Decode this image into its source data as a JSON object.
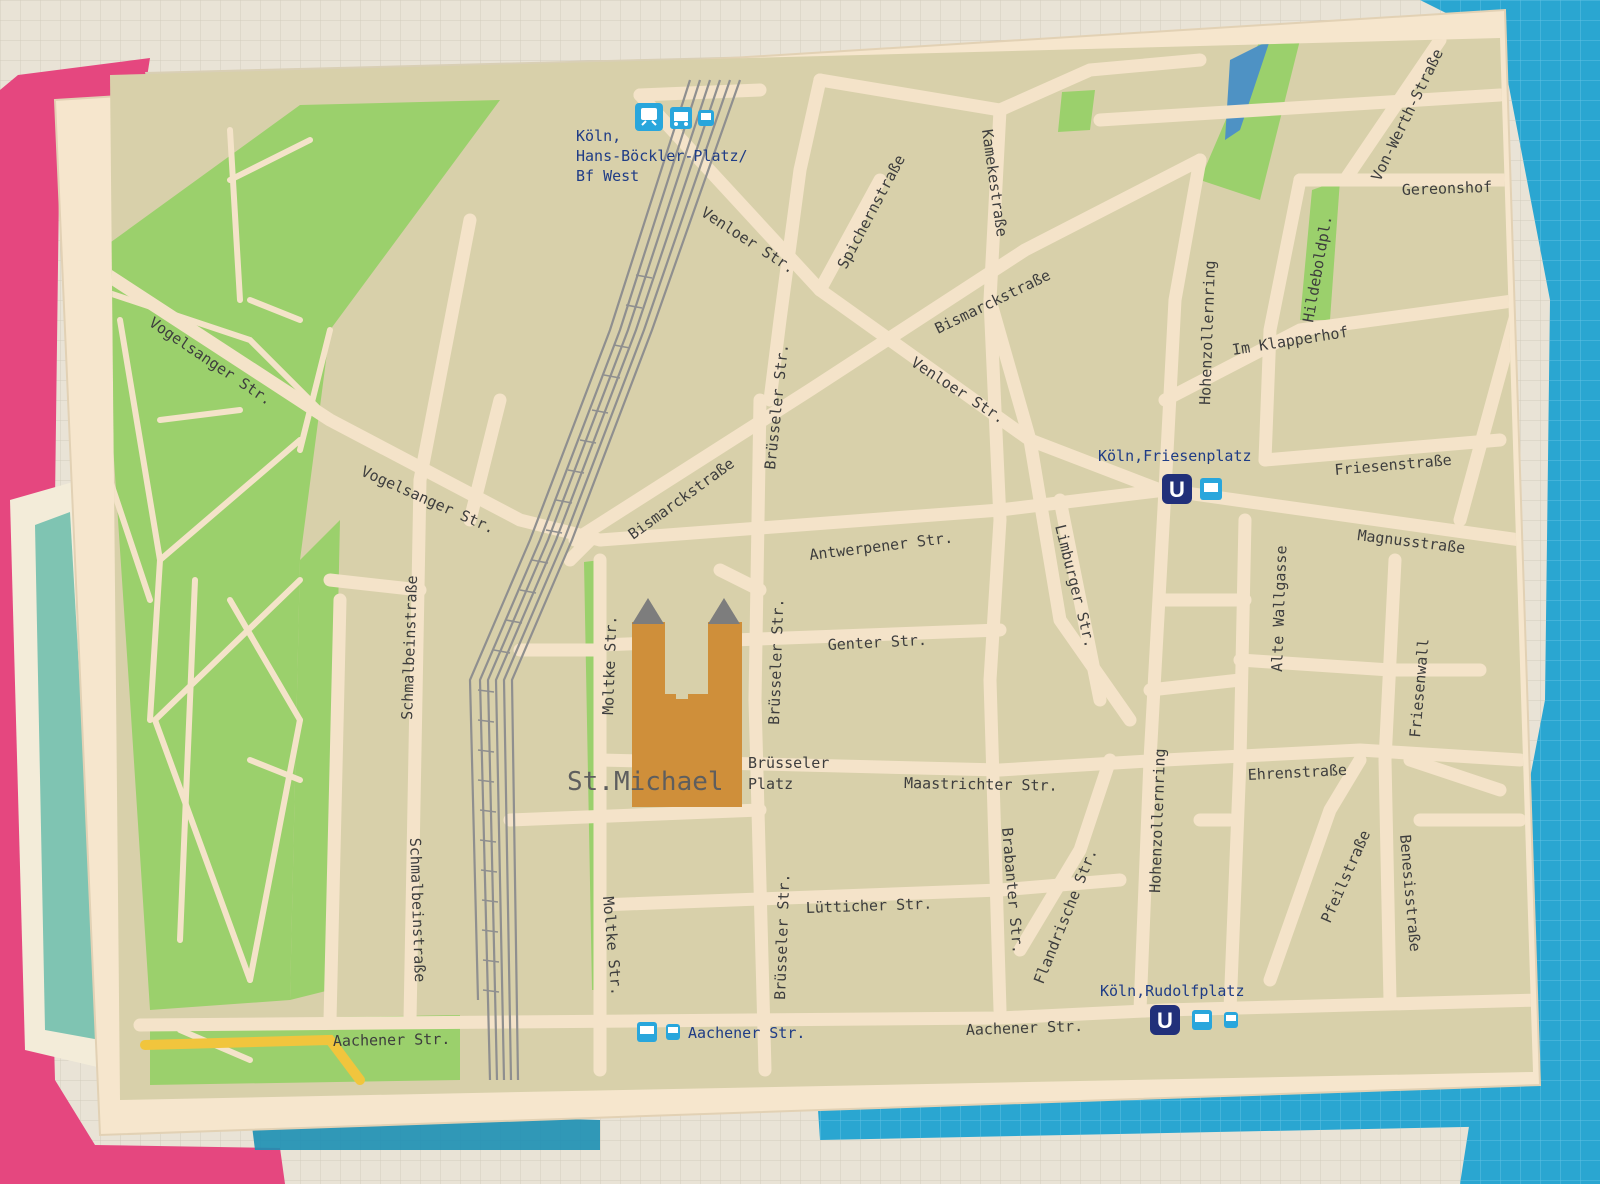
{
  "colors": {
    "paper_bg": "#e9e3d6",
    "card": "#f6e6cd",
    "block": "#d8d0aa",
    "road": "#f4e3c9",
    "park": "#9bd06c",
    "rail": "#8f8f8f",
    "church": "#cf8f3a",
    "church_roof": "#7d7d7d",
    "tape_pink": "#e5477f",
    "tape_blue": "#2aa6d1",
    "ubahn": "#21307a",
    "transit_icon": "#29a6dc",
    "station_text": "#1f3c86",
    "yellow_road": "#f1c53d"
  },
  "streets": {
    "vogelsanger_1": "Vogelsanger Str.",
    "vogelsanger_2": "Vogelsanger Str.",
    "venloer_1": "Venloer Str.",
    "venloer_2": "Venloer Str.",
    "spichern": "Spichernstraße",
    "kameke": "Kamekestraße",
    "bismarck_1": "Bismarckstraße",
    "bismarck_2": "Bismarckstraße",
    "bruesseler_1": "Brüsseler Str.",
    "bruesseler_2": "Brüsseler Str.",
    "bruesseler_3": "Brüsseler Str.",
    "antwerpener": "Antwerpener Str.",
    "genter": "Genter Str.",
    "moltke_1": "Moltke Str.",
    "moltke_2": "Moltke Str.",
    "schmalbein_1": "Schmalbeinstraße",
    "schmalbein_2": "Schmalbeinstraße",
    "maastrichter": "Maastrichter Str.",
    "luetticher": "Lütticher Str.",
    "brabanter": "Brabanter Str.",
    "flandrische": "Flandrische Str.",
    "limburger": "Limburger Str.",
    "hohenzollernring_1": "Hohenzollernring",
    "hohenzollernring_2": "Hohenzollernring",
    "aachener_1": "Aachener Str.",
    "aachener_2": "Aachener Str.",
    "aachener_3": "Aachener Str.",
    "im_klapperhof": "Im Klapperhof",
    "hildeboldpl": "Hildeboldpl.",
    "gereonshof": "Gereonshof",
    "von_werth": "Von-Werth-Straße",
    "friesenstrasse": "Friesenstraße",
    "magnusstrasse": "Magnusstraße",
    "alte_wallgasse": "Alte Wallgasse",
    "friesenwall": "Friesenwall",
    "ehrenstrasse": "Ehrenstraße",
    "pfeilstrasse": "Pfeilstraße",
    "benesisstrasse": "Benesisstraße"
  },
  "places": {
    "st_michael": "St.Michael",
    "bruesseler_platz_1": "Brüsseler",
    "bruesseler_platz_2": "Platz"
  },
  "stations": {
    "west_1": "Köln,",
    "west_2": "Hans-Böckler-Platz/",
    "west_3": "Bf West",
    "friesenplatz": "Köln,Friesenplatz",
    "rudolfplatz": "Köln,Rudolfplatz",
    "ubahn_symbol": "U"
  },
  "icons": [
    "train-icon",
    "tram-icon",
    "bus-icon",
    "ubahn-icon",
    "church-icon"
  ]
}
